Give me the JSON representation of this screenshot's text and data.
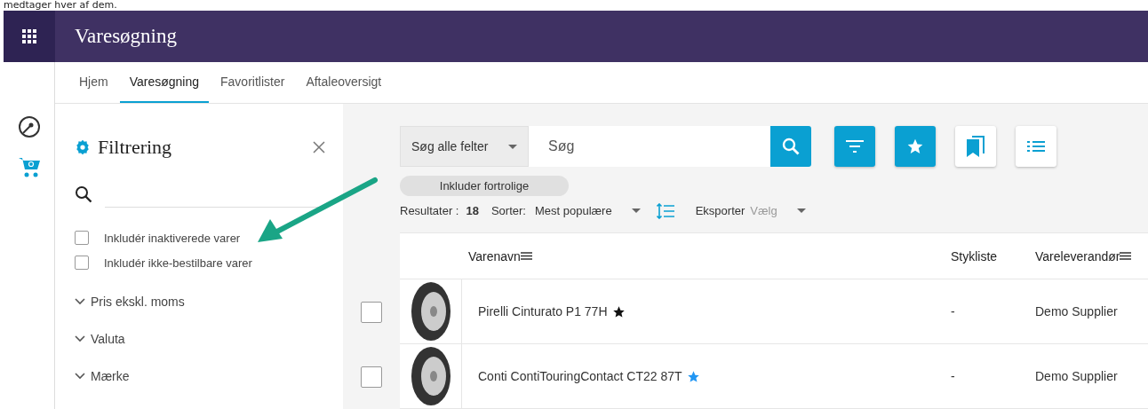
{
  "caption_fragment": "medtager hver af dem.",
  "app_bar": {
    "title": "Varesøgning"
  },
  "tabs": [
    {
      "label": "Hjem",
      "selected": false
    },
    {
      "label": "Varesøgning",
      "selected": true
    },
    {
      "label": "Favoritlister",
      "selected": false
    },
    {
      "label": "Aftaleoversigt",
      "selected": false
    }
  ],
  "rail": [
    {
      "kind": "dashboard",
      "selected": false
    },
    {
      "kind": "cart",
      "selected": true
    }
  ],
  "filter_panel": {
    "title": "Filtrering",
    "checkboxes": [
      {
        "label": "Inkludér inaktiverede varer",
        "checked": false
      },
      {
        "label": "Inkludér ikke-bestilbare varer",
        "checked": false
      }
    ],
    "sections": [
      {
        "label": "Pris ekskl. moms",
        "expanded": false
      },
      {
        "label": "Valuta",
        "expanded": false
      },
      {
        "label": "Mærke",
        "expanded": false
      }
    ]
  },
  "search": {
    "scope": "Søg alle felter",
    "placeholder": "Søg"
  },
  "toolbar_buttons": [
    {
      "kind": "filter",
      "selected": true
    },
    {
      "kind": "star",
      "selected": true
    },
    {
      "kind": "bookmarks",
      "selected": false
    },
    {
      "kind": "list",
      "selected": false
    }
  ],
  "chip": "Inkluder fortrolige",
  "results": {
    "label": "Resultater :",
    "count": "18",
    "sort_label": "Sorter:",
    "sort_value": "Mest populære",
    "export_label": "Eksporter",
    "export_placeholder": "Vælg"
  },
  "table": {
    "columns": [
      "Varenavn",
      "Stykliste",
      "Vareleverandør"
    ],
    "rows": [
      {
        "name": "Pirelli Cinturato P1 77H",
        "color": "#111111",
        "stykliste": "-",
        "supplier": "Demo Supplier",
        "checked": false
      },
      {
        "name": "Conti ContiTouringContact CT22 87T",
        "color": "#2196f3",
        "stykliste": "-",
        "supplier": "Demo Supplier",
        "checked": false
      }
    ]
  }
}
